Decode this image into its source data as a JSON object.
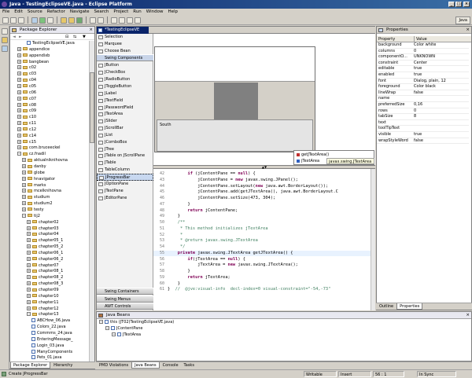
{
  "window": {
    "title": "Java - TestingEclipseVE.java - Eclipse Platform"
  },
  "menu": [
    "File",
    "Edit",
    "Source",
    "Refactor",
    "Navigate",
    "Search",
    "Project",
    "Run",
    "Window",
    "Help"
  ],
  "toolbar": {
    "perspective": "Java"
  },
  "package_explorer": {
    "title": "Package Explorer",
    "rows": [
      {
        "label": "TestingEclipseVE.java",
        "kind": "file",
        "indent": 3
      },
      {
        "label": "appendice",
        "kind": "pkg",
        "indent": 1
      },
      {
        "label": "appendixb",
        "kind": "pkg",
        "indent": 1
      },
      {
        "label": "bangbean",
        "kind": "pkg",
        "indent": 1
      },
      {
        "label": "c02",
        "kind": "pkg",
        "indent": 1
      },
      {
        "label": "c03",
        "kind": "pkg",
        "indent": 1
      },
      {
        "label": "c04",
        "kind": "pkg",
        "indent": 1
      },
      {
        "label": "c05",
        "kind": "pkg",
        "indent": 1
      },
      {
        "label": "c06",
        "kind": "pkg",
        "indent": 1
      },
      {
        "label": "c07",
        "kind": "pkg",
        "indent": 1
      },
      {
        "label": "c08",
        "kind": "pkg",
        "indent": 1
      },
      {
        "label": "c09",
        "kind": "pkg",
        "indent": 1
      },
      {
        "label": "c10",
        "kind": "pkg",
        "indent": 1
      },
      {
        "label": "c11",
        "kind": "pkg",
        "indent": 1
      },
      {
        "label": "c12",
        "kind": "pkg",
        "indent": 1
      },
      {
        "label": "c14",
        "kind": "pkg",
        "indent": 1
      },
      {
        "label": "c15",
        "kind": "pkg",
        "indent": 1
      },
      {
        "label": "com.bruceeckel",
        "kind": "pkg",
        "indent": 1
      },
      {
        "label": "cz.fnadil",
        "kind": "pkg",
        "indent": 1,
        "open": true
      },
      {
        "label": "aktualniknihovna",
        "kind": "pkg",
        "indent": 2
      },
      {
        "label": "danby",
        "kind": "pkg",
        "indent": 2
      },
      {
        "label": "globe",
        "kind": "pkg",
        "indent": 2
      },
      {
        "label": "hnavigator",
        "kind": "pkg",
        "indent": 2
      },
      {
        "label": "marks",
        "kind": "pkg",
        "indent": 2
      },
      {
        "label": "mcelknihovna",
        "kind": "pkg",
        "indent": 2
      },
      {
        "label": "studium",
        "kind": "pkg",
        "indent": 2
      },
      {
        "label": "studium2",
        "kind": "pkg",
        "indent": 2
      },
      {
        "label": "testy",
        "kind": "pkg",
        "indent": 2
      },
      {
        "label": "tij2",
        "kind": "pkg",
        "indent": 2,
        "open": true
      },
      {
        "label": "chapter02",
        "kind": "pkg",
        "indent": 3
      },
      {
        "label": "chapter03",
        "kind": "pkg",
        "indent": 3
      },
      {
        "label": "chapter04",
        "kind": "pkg",
        "indent": 3
      },
      {
        "label": "chapter05_1",
        "kind": "pkg",
        "indent": 3
      },
      {
        "label": "chapter05_2",
        "kind": "pkg",
        "indent": 3
      },
      {
        "label": "chapter06_1",
        "kind": "pkg",
        "indent": 3
      },
      {
        "label": "chapter06_2",
        "kind": "pkg",
        "indent": 3
      },
      {
        "label": "chapter07",
        "kind": "pkg",
        "indent": 3
      },
      {
        "label": "chapter08_1",
        "kind": "pkg",
        "indent": 3
      },
      {
        "label": "chapter08_2",
        "kind": "pkg",
        "indent": 3
      },
      {
        "label": "chapter08_3",
        "kind": "pkg",
        "indent": 3
      },
      {
        "label": "chapter09",
        "kind": "pkg",
        "indent": 3
      },
      {
        "label": "chapter10",
        "kind": "pkg",
        "indent": 3
      },
      {
        "label": "chapter11",
        "kind": "pkg",
        "indent": 3
      },
      {
        "label": "chapter12",
        "kind": "pkg",
        "indent": 3
      },
      {
        "label": "chapter13",
        "kind": "pkg",
        "indent": 3,
        "open": true
      },
      {
        "label": "ABCHow_06.java",
        "kind": "file",
        "indent": 4
      },
      {
        "label": "Colors_22.java",
        "kind": "file",
        "indent": 4
      },
      {
        "label": "Commms_24.java",
        "kind": "file",
        "indent": 4
      },
      {
        "label": "EnteringMessage_",
        "kind": "file",
        "indent": 4
      },
      {
        "label": "Login_03.java",
        "kind": "file",
        "indent": 4
      },
      {
        "label": "ManyComponents",
        "kind": "file",
        "indent": 4
      },
      {
        "label": "Pets_01.java",
        "kind": "file",
        "indent": 4
      }
    ],
    "tabs": [
      "Package Explorer",
      "Hierarchy"
    ]
  },
  "editor": {
    "tab": "*TestingEclipseVE",
    "palette": {
      "top": [
        "Selection",
        "Marquee",
        "Choose Bean"
      ],
      "category": "Swing Components",
      "items": [
        "JButton",
        "JCheckBox",
        "JRadioButton",
        "JToggleButton",
        "JLabel",
        "JTextField",
        "JPasswordField",
        "JTextArea",
        "JSlider",
        "JScrollBar",
        "JList",
        "JComboBox",
        "JTree",
        "JTable on JScrollPane",
        "JTable",
        "TableColumn",
        "JProgressBar",
        "JOptionPane",
        "JTextPane",
        "JEditorPane"
      ],
      "bottom": [
        "Swing Containers",
        "Swing Menus",
        "AWT Controls"
      ]
    },
    "canvas": {
      "south_label": "South",
      "popup": [
        "getJTextArea()",
        "jTextArea"
      ],
      "popup_hint": "javax.swing.JTextArea"
    },
    "code": [
      {
        "n": "42",
        "t": "        if (jContentPane == null) {"
      },
      {
        "n": "43",
        "t": "            jContentPane = new javax.swing.JPanel();"
      },
      {
        "n": "44",
        "t": "            jContentPane.setLayout(new java.awt.BorderLayout());"
      },
      {
        "n": "45",
        "t": "            jContentPane.add(getJTextArea(), java.awt.BorderLayout.C"
      },
      {
        "n": "46",
        "t": "            jContentPane.setSize(473, 304);"
      },
      {
        "n": "47",
        "t": "        }"
      },
      {
        "n": "48",
        "t": "        return jContentPane;"
      },
      {
        "n": "49",
        "t": "    }"
      },
      {
        "n": "50",
        "t": "    /**"
      },
      {
        "n": "51",
        "t": "     * This method initializes jTextArea"
      },
      {
        "n": "52",
        "t": "     *"
      },
      {
        "n": "53",
        "t": "     * @return javax.swing.JTextArea"
      },
      {
        "n": "54",
        "t": "     */"
      },
      {
        "n": "55",
        "t": "    private javax.swing.JTextArea getJTextArea() {"
      },
      {
        "n": "56",
        "t": "        if(jTextArea == null) {"
      },
      {
        "n": "57",
        "t": "            jTextArea = new javax.swing.JTextArea();"
      },
      {
        "n": "58",
        "t": "        }"
      },
      {
        "n": "59",
        "t": "        return jTextArea;"
      },
      {
        "n": "60",
        "t": "    }"
      },
      {
        "n": "61",
        "t": "}  //  @jve:visual-info  decl-index=0 visual-constraint=\"-54,-73\""
      }
    ],
    "highlight_line": "55"
  },
  "properties": {
    "title": "Properties",
    "col_property": "Property",
    "col_value": "Value",
    "rows": [
      [
        "background",
        "Color white"
      ],
      [
        "columns",
        "0"
      ],
      [
        "componentO...",
        "UNKNOWN"
      ],
      [
        "constraint",
        "Center"
      ],
      [
        "editable",
        "true"
      ],
      [
        "enabled",
        "true"
      ],
      [
        "font",
        "Dialog, plain, 12"
      ],
      [
        "foreground",
        "Color black"
      ],
      [
        "lineWrap",
        "false"
      ],
      [
        "name",
        ""
      ],
      [
        "preferredSize",
        "0,16"
      ],
      [
        "rows",
        "0"
      ],
      [
        "tabSize",
        "8"
      ],
      [
        "text",
        ""
      ],
      [
        "toolTipText",
        ""
      ],
      [
        "visible",
        "true"
      ],
      [
        "wrapStyleWord",
        "false"
      ]
    ],
    "tabs": [
      "Outline",
      "Properties"
    ]
  },
  "java_beans": {
    "title": "Java Beans",
    "rows": [
      {
        "label": "this (JT02)TestingEclipseVE.java)",
        "indent": 0
      },
      {
        "label": "JContentPane",
        "indent": 1
      },
      {
        "label": "JTextArea",
        "indent": 2
      }
    ],
    "tabs": [
      "PMD Violations",
      "Java Beans",
      "Console",
      "Tasks"
    ]
  },
  "status": {
    "left": "Create JProgressBar",
    "writable": "Writable",
    "insert": "Insert",
    "pos": "56 : 1",
    "sync": "In Sync"
  }
}
